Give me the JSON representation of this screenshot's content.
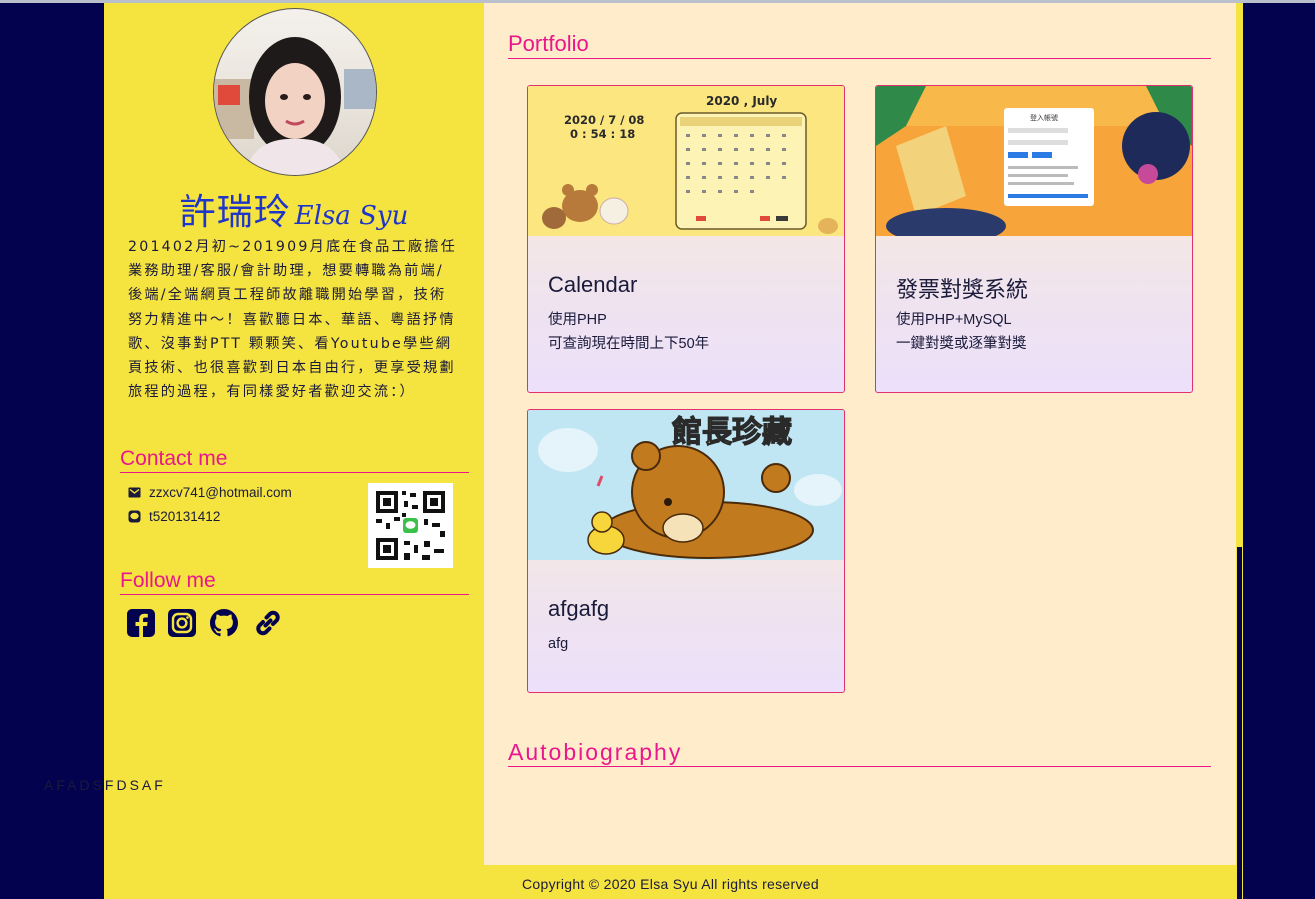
{
  "colors": {
    "page_bg": "#02024f",
    "sidebar_bg": "#f5e340",
    "main_bg": "#ffecca",
    "accent": "#e9168c",
    "name_blue": "#1e35c9"
  },
  "profile": {
    "name_zh": "許瑞玲",
    "name_en": "Elsa Syu",
    "bio": "201402月初~201909月底在食品工廠擔任業務助理/客服/會計助理，想要轉職為前端/後端/全端網頁工程師故離職開始學習，技術努力精進中～！喜歡聽日本、華語、粵語抒情歌、沒事對PTT 颗颗笑、看Youtube學些網頁技術、也很喜歡到日本自由行，更享受規劃旅程的過程，有同樣愛好者歡迎交流：）"
  },
  "contact": {
    "heading": "Contact me",
    "email": "zzxcv741@hotmail.com",
    "line_id": "t520131412",
    "email_icon": "envelope-icon",
    "line_icon": "line-icon"
  },
  "follow": {
    "heading": "Follow me",
    "icons": [
      "facebook-icon",
      "instagram-icon",
      "github-icon",
      "link-icon"
    ]
  },
  "portfolio": {
    "heading": "Portfolio",
    "cards": [
      {
        "title": "Calendar",
        "desc_lines": [
          "使用PHP",
          "可查詢現在時間上下50年"
        ],
        "thumb": {
          "date": "2020 / 7 / 08",
          "time": "0 : 54 : 18",
          "month": "2020 , July"
        }
      },
      {
        "title": "發票對獎系統",
        "desc_lines": [
          "使用PHP+MySQL",
          "一鍵對獎或逐筆對獎"
        ],
        "thumb": {
          "panel_title": "登入帳號"
        }
      },
      {
        "title": "afgafg",
        "desc_lines": [
          "afg"
        ],
        "thumb": {
          "caption": "館長珍藏"
        }
      }
    ]
  },
  "autobiography": {
    "heading": "Autobiography",
    "text": "AFADSFDSAF"
  },
  "footer": {
    "copyright": "Copyright © 2020 Elsa Syu All rights reserved"
  }
}
